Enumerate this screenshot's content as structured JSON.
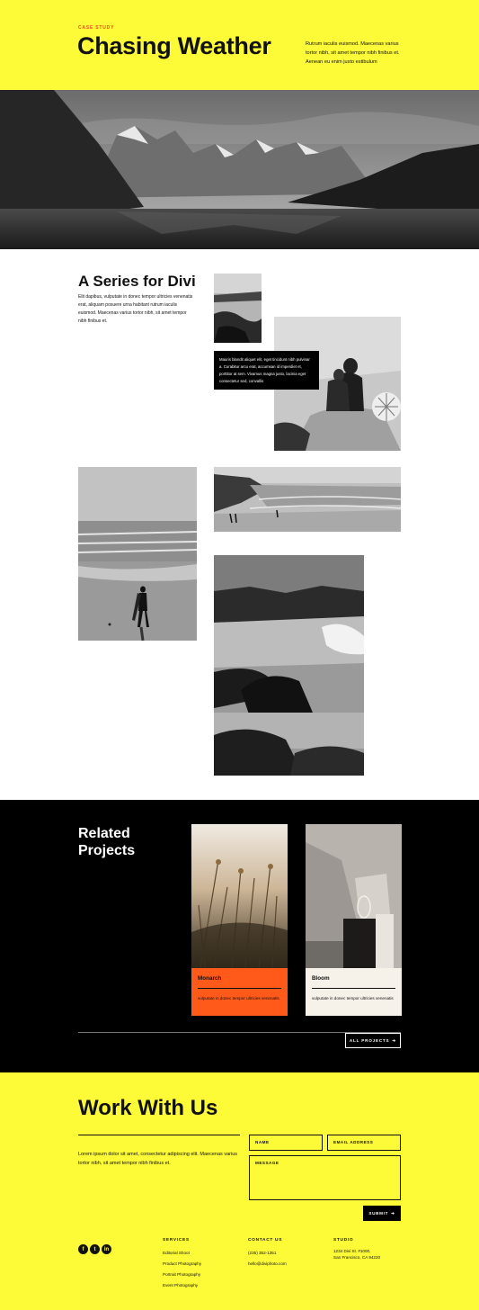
{
  "hero": {
    "eyebrow": "CASE STUDY",
    "title": "Chasing Weather",
    "description": "Rutrum iaculis euismod. Maecenas varius tortor nibh, sit amet tempor nibh finibus et. Aenean eu enim justo estibulum"
  },
  "series": {
    "title": "A Series for Divi",
    "description": "Elit dapibus, vulputate in donec tempor ultricies venenatis erat, aliquam posuere urna habitant rutrum iaculis euismod. Maecenas varius tortor nibh, sit amet tempor nibh finibus et.",
    "caption": "Mauris blandit aliquet elit, eget tincidunt nibh pulvinar a. Curabitur arcu erat, accumsan id imperdiet et, porttitor at sem. Vivamus magna justo, lacinia eget consectetur sed, convallis"
  },
  "related": {
    "title": "Related Projects",
    "projects": [
      {
        "name": "Monarch",
        "description": "vulputate in donec tempor ultricies venenatis"
      },
      {
        "name": "Bloom",
        "description": "vulputate in donec tempor ultricies venenatis"
      }
    ],
    "all_projects_label": "ALL PROJECTS",
    "arrow": "➔"
  },
  "work": {
    "title": "Work With Us",
    "description": "Lorem ipsum dolor sit amet, consectetur adipiscing elit. Maecenas varius tortor nibh, sit amet tempor nibh finibus et.",
    "name_placeholder": "NAME",
    "email_placeholder": "EMAIL ADDRESS",
    "message_placeholder": "MESSAGE",
    "submit_label": "SUBMIT",
    "submit_arrow": "➔"
  },
  "footer": {
    "social": [
      "f",
      "t",
      "in"
    ],
    "services": {
      "heading": "SERVICES",
      "items": [
        "Editorial Shoot",
        "Product Photography",
        "Portrait Photography",
        "Event Photography"
      ]
    },
    "contact": {
      "heading": "CONTACT US",
      "phone": "(235) 352-1351",
      "email": "hello@diviphoto.com"
    },
    "studio": {
      "heading": "STUDIO",
      "address_line1": "1234 Divi St. #1000,",
      "address_line2": "San Francisco, CA 94220"
    }
  },
  "colors": {
    "yellow": "#fdfa37",
    "orange": "#ff5a1a",
    "black": "#000000"
  }
}
